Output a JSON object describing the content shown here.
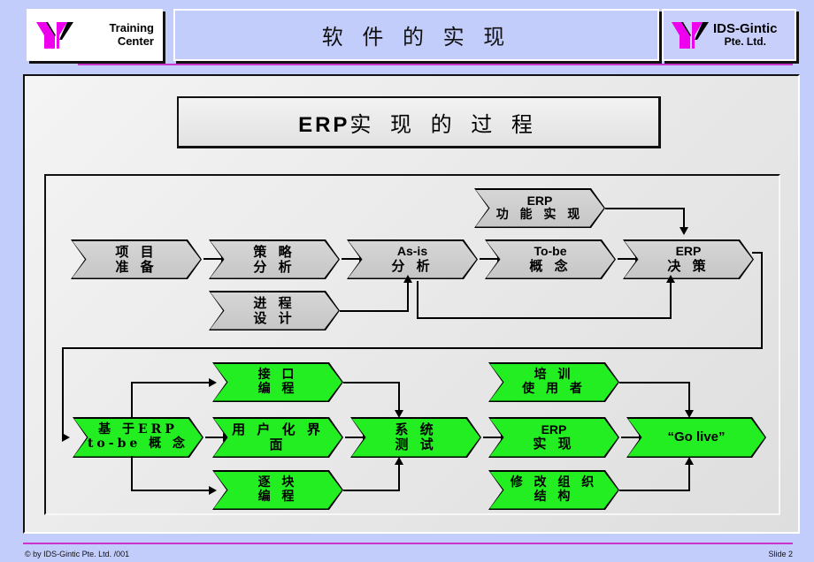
{
  "banner": {
    "title": "软 件 的 实 现",
    "logo_left": {
      "line1": "Training",
      "line2": "Center",
      "icon": "y-logo-icon"
    },
    "logo_right": {
      "line1": "IDS-Gintic",
      "line2": "Pte. Ltd.",
      "icon": "y-logo-icon"
    }
  },
  "slide": {
    "title_latin": "ERP",
    "title_cjk": "实 现 的 过 程"
  },
  "colors": {
    "background": "#c3cdfb",
    "panel": "#eaeaea",
    "accent_rule": "#cc33cc",
    "logo_magenta": "#ee00ee",
    "chevron_gray": "#cccccc",
    "chevron_green": "#22ee22"
  },
  "flow": {
    "row_top": [
      {
        "id": "erp-function",
        "line1": "ERP",
        "line2": "功 能 实 现",
        "style": "gray"
      }
    ],
    "row_main": [
      {
        "id": "project-prep",
        "line1": "项 目",
        "line2": "准 备",
        "style": "gray"
      },
      {
        "id": "strategy",
        "line1": "策 略",
        "line2": "分 析",
        "style": "gray"
      },
      {
        "id": "as-is",
        "line1": "As-is",
        "line2": "分 析",
        "style": "gray"
      },
      {
        "id": "to-be",
        "line1": "To-be",
        "line2": "概 念",
        "style": "gray"
      },
      {
        "id": "erp-decision",
        "line1": "ERP",
        "line2": "决 策",
        "style": "gray"
      }
    ],
    "row_below": [
      {
        "id": "process-design",
        "line1": "进 程",
        "line2": "设 计",
        "style": "gray"
      }
    ],
    "row_green_upper": [
      {
        "id": "interface-prog",
        "line1": "接 口",
        "line2": "编 程",
        "style": "green"
      },
      {
        "id": "train-users",
        "line1": "培 训",
        "line2": "使 用 者",
        "style": "green"
      }
    ],
    "row_green_middle": [
      {
        "id": "erp-to-be-concept",
        "line1": "基 于ERP",
        "line2": "to-be 概 念",
        "style": "green"
      },
      {
        "id": "user-interface",
        "line1": "用 户 化 界 面",
        "line2": "",
        "style": "green"
      },
      {
        "id": "system-test",
        "line1": "系 统",
        "line2": "测 试",
        "style": "green"
      },
      {
        "id": "erp-realize",
        "line1": "ERP",
        "line2": "实 现",
        "style": "green"
      },
      {
        "id": "go-live",
        "line1": "“Go live”",
        "line2": "",
        "style": "green"
      }
    ],
    "row_green_lower": [
      {
        "id": "module-prog",
        "line1": "逐 块",
        "line2": "编 程",
        "style": "green"
      },
      {
        "id": "org-change",
        "line1": "修 改 组 织",
        "line2": "结 构",
        "style": "green"
      }
    ]
  },
  "footer": {
    "copyright": "© by IDS-Gintic Pte. Ltd. /001",
    "slide_number": "Slide 2"
  }
}
